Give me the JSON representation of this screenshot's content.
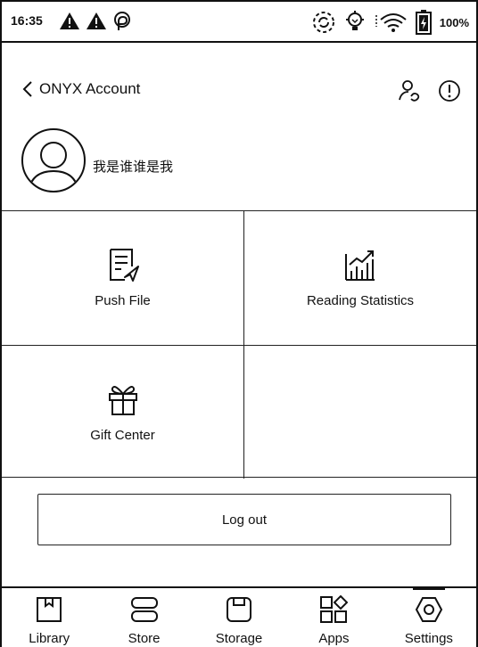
{
  "status_bar": {
    "time": "16:35",
    "battery_percent_text": "100%"
  },
  "header": {
    "back_label": "ONYX Account"
  },
  "profile": {
    "username": "我是谁谁是我"
  },
  "grid": {
    "items": [
      {
        "label": "Push File",
        "icon": "push-file-icon"
      },
      {
        "label": "Reading Statistics",
        "icon": "reading-statistics-icon"
      },
      {
        "label": "Gift Center",
        "icon": "gift-icon"
      }
    ]
  },
  "actions": {
    "logout_label": "Log out"
  },
  "bottom_nav": {
    "items": [
      {
        "label": "Library",
        "icon": "library-icon"
      },
      {
        "label": "Store",
        "icon": "store-icon"
      },
      {
        "label": "Storage",
        "icon": "storage-icon"
      },
      {
        "label": "Apps",
        "icon": "apps-icon"
      },
      {
        "label": "Settings",
        "icon": "settings-icon",
        "active": true
      }
    ]
  },
  "colors": {
    "foreground": "#111111",
    "background": "#ffffff"
  }
}
